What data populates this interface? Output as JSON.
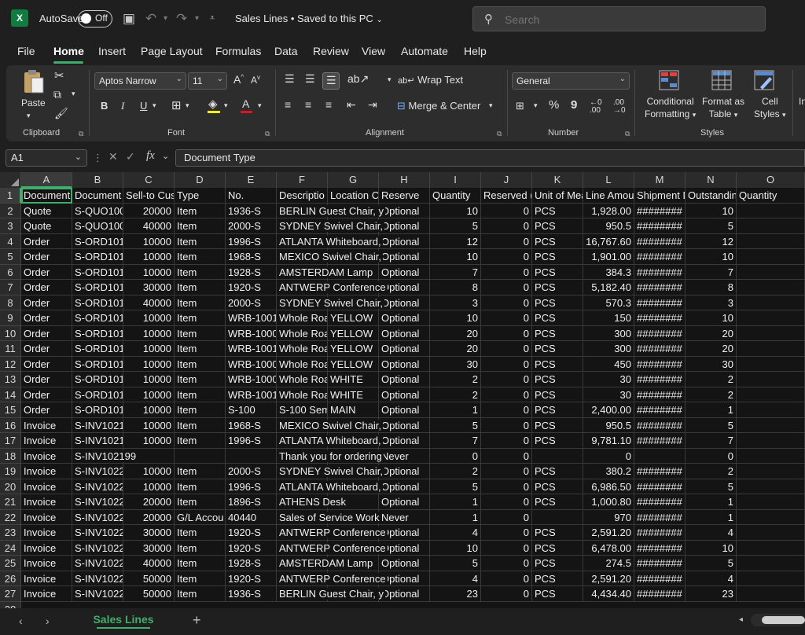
{
  "titlebar": {
    "app_icon": "X",
    "autosave_label": "AutoSave",
    "autosave_state": "Off",
    "doc_title": "Sales Lines • Saved to this PC",
    "search_placeholder": "Search"
  },
  "menu": {
    "tabs": [
      "File",
      "Home",
      "Insert",
      "Page Layout",
      "Formulas",
      "Data",
      "Review",
      "View",
      "Automate",
      "Help"
    ],
    "active": "Home"
  },
  "ribbon": {
    "clipboard": {
      "label": "Clipboard",
      "paste": "Paste"
    },
    "font": {
      "label": "Font",
      "family": "Aptos Narrow",
      "size": "11",
      "bold": "B",
      "italic": "I",
      "underline": "U"
    },
    "alignment": {
      "label": "Alignment",
      "wrap": "Wrap Text",
      "merge": "Merge & Center"
    },
    "number": {
      "label": "Number",
      "format": "General",
      "percent": "%",
      "comma": "9"
    },
    "styles": {
      "label": "Styles",
      "conditional": [
        "Conditional",
        "Formatting"
      ],
      "format_table": [
        "Format as",
        "Table"
      ],
      "cell_styles": [
        "Cell",
        "Styles"
      ],
      "more": "In"
    }
  },
  "formula_bar": {
    "name_box": "A1",
    "fx": "fx",
    "content": "Document Type"
  },
  "columns": [
    "A",
    "B",
    "C",
    "D",
    "E",
    "F",
    "G",
    "H",
    "I",
    "J",
    "K",
    "L",
    "M",
    "N",
    "O"
  ],
  "header_row": [
    "Document",
    "Document",
    "Sell-to Cus",
    "Type",
    "No.",
    "Descriptio",
    "Location C",
    "Reserve",
    "Quantity",
    "Reserved (",
    "Unit of Mea",
    "Line Amou",
    "Shipment D",
    "Outstanding",
    "Quantity"
  ],
  "rows": [
    [
      "Quote",
      "S-QUO100",
      "20000",
      "Item",
      "1936-S",
      "BERLIN Guest Chair, y",
      "",
      "Optional",
      "10",
      "0",
      "PCS",
      "1,928.00",
      "########",
      "10"
    ],
    [
      "Quote",
      "S-QUO100",
      "40000",
      "Item",
      "2000-S",
      "SYDNEY Swivel Chair,",
      "",
      "Optional",
      "5",
      "0",
      "PCS",
      "950.5",
      "########",
      "5"
    ],
    [
      "Order",
      "S-ORD101",
      "10000",
      "Item",
      "1996-S",
      "ATLANTA Whiteboard,",
      "",
      "Optional",
      "12",
      "0",
      "PCS",
      "16,767.60",
      "########",
      "12"
    ],
    [
      "Order",
      "S-ORD101",
      "10000",
      "Item",
      "1968-S",
      "MEXICO Swivel Chair,",
      "",
      "Optional",
      "10",
      "0",
      "PCS",
      "1,901.00",
      "########",
      "10"
    ],
    [
      "Order",
      "S-ORD101",
      "10000",
      "Item",
      "1928-S",
      "AMSTERDAM Lamp",
      "",
      "Optional",
      "7",
      "0",
      "PCS",
      "384.3",
      "########",
      "7"
    ],
    [
      "Order",
      "S-ORD101",
      "30000",
      "Item",
      "1920-S",
      "ANTWERP Conference",
      "",
      "Optional",
      "8",
      "0",
      "PCS",
      "5,182.40",
      "########",
      "8"
    ],
    [
      "Order",
      "S-ORD101",
      "40000",
      "Item",
      "2000-S",
      "SYDNEY Swivel Chair,",
      "",
      "Optional",
      "3",
      "0",
      "PCS",
      "570.3",
      "########",
      "3"
    ],
    [
      "Order",
      "S-ORD101",
      "10000",
      "Item",
      "WRB-1001",
      "Whole Roa",
      "YELLOW",
      "Optional",
      "10",
      "0",
      "PCS",
      "150",
      "########",
      "10"
    ],
    [
      "Order",
      "S-ORD101",
      "10000",
      "Item",
      "WRB-1000",
      "Whole Roa",
      "YELLOW",
      "Optional",
      "20",
      "0",
      "PCS",
      "300",
      "########",
      "20"
    ],
    [
      "Order",
      "S-ORD101",
      "10000",
      "Item",
      "WRB-1001",
      "Whole Roa",
      "YELLOW",
      "Optional",
      "20",
      "0",
      "PCS",
      "300",
      "########",
      "20"
    ],
    [
      "Order",
      "S-ORD101",
      "10000",
      "Item",
      "WRB-1000",
      "Whole Roa",
      "YELLOW",
      "Optional",
      "30",
      "0",
      "PCS",
      "450",
      "########",
      "30"
    ],
    [
      "Order",
      "S-ORD101",
      "10000",
      "Item",
      "WRB-1000",
      "Whole Roa",
      "WHITE",
      "Optional",
      "2",
      "0",
      "PCS",
      "30",
      "########",
      "2"
    ],
    [
      "Order",
      "S-ORD101",
      "10000",
      "Item",
      "WRB-1001",
      "Whole Roa",
      "WHITE",
      "Optional",
      "2",
      "0",
      "PCS",
      "30",
      "########",
      "2"
    ],
    [
      "Order",
      "S-ORD101",
      "10000",
      "Item",
      "S-100",
      "S-100 Sem",
      "MAIN",
      "Optional",
      "1",
      "0",
      "PCS",
      "2,400.00",
      "########",
      "1"
    ],
    [
      "Invoice",
      "S-INV1021",
      "10000",
      "Item",
      "1968-S",
      "MEXICO Swivel Chair,",
      "",
      "Optional",
      "5",
      "0",
      "PCS",
      "950.5",
      "########",
      "5"
    ],
    [
      "Invoice",
      "S-INV1021",
      "10000",
      "Item",
      "1996-S",
      "ATLANTA Whiteboard,",
      "",
      "Optional",
      "7",
      "0",
      "PCS",
      "9,781.10",
      "########",
      "7"
    ],
    [
      "Invoice",
      "S-INV102199",
      "",
      "",
      "",
      "Thank you for ordering",
      "",
      "Never",
      "0",
      "0",
      "",
      "0",
      "",
      "0"
    ],
    [
      "Invoice",
      "S-INV1022",
      "10000",
      "Item",
      "2000-S",
      "SYDNEY Swivel Chair,",
      "",
      "Optional",
      "2",
      "0",
      "PCS",
      "380.2",
      "########",
      "2"
    ],
    [
      "Invoice",
      "S-INV1022",
      "10000",
      "Item",
      "1996-S",
      "ATLANTA Whiteboard,",
      "",
      "Optional",
      "5",
      "0",
      "PCS",
      "6,986.50",
      "########",
      "5"
    ],
    [
      "Invoice",
      "S-INV1022",
      "20000",
      "Item",
      "1896-S",
      "ATHENS Desk",
      "",
      "Optional",
      "1",
      "0",
      "PCS",
      "1,000.80",
      "########",
      "1"
    ],
    [
      "Invoice",
      "S-INV1022",
      "20000",
      "G/L Accou",
      "40440",
      "Sales of Service Work",
      "",
      "Never",
      "1",
      "0",
      "",
      "970",
      "########",
      "1"
    ],
    [
      "Invoice",
      "S-INV1022",
      "30000",
      "Item",
      "1920-S",
      "ANTWERP Conference",
      "",
      "Optional",
      "4",
      "0",
      "PCS",
      "2,591.20",
      "########",
      "4"
    ],
    [
      "Invoice",
      "S-INV1022",
      "30000",
      "Item",
      "1920-S",
      "ANTWERP Conference",
      "",
      "Optional",
      "10",
      "0",
      "PCS",
      "6,478.00",
      "########",
      "10"
    ],
    [
      "Invoice",
      "S-INV1022",
      "40000",
      "Item",
      "1928-S",
      "AMSTERDAM Lamp",
      "",
      "Optional",
      "5",
      "0",
      "PCS",
      "274.5",
      "########",
      "5"
    ],
    [
      "Invoice",
      "S-INV1022",
      "50000",
      "Item",
      "1920-S",
      "ANTWERP Conference",
      "",
      "Optional",
      "4",
      "0",
      "PCS",
      "2,591.20",
      "########",
      "4"
    ],
    [
      "Invoice",
      "S-INV1022",
      "50000",
      "Item",
      "1936-S",
      "BERLIN Guest Chair, y",
      "",
      "Optional",
      "23",
      "0",
      "PCS",
      "4,434.40",
      "########",
      "23"
    ]
  ],
  "sheet_tabs": {
    "active": "Sales Lines",
    "add": "+"
  },
  "colors": {
    "accent": "#3fae6a",
    "excel_green": "#107c41",
    "background": "#1f1f1f",
    "grid": "#141414"
  }
}
